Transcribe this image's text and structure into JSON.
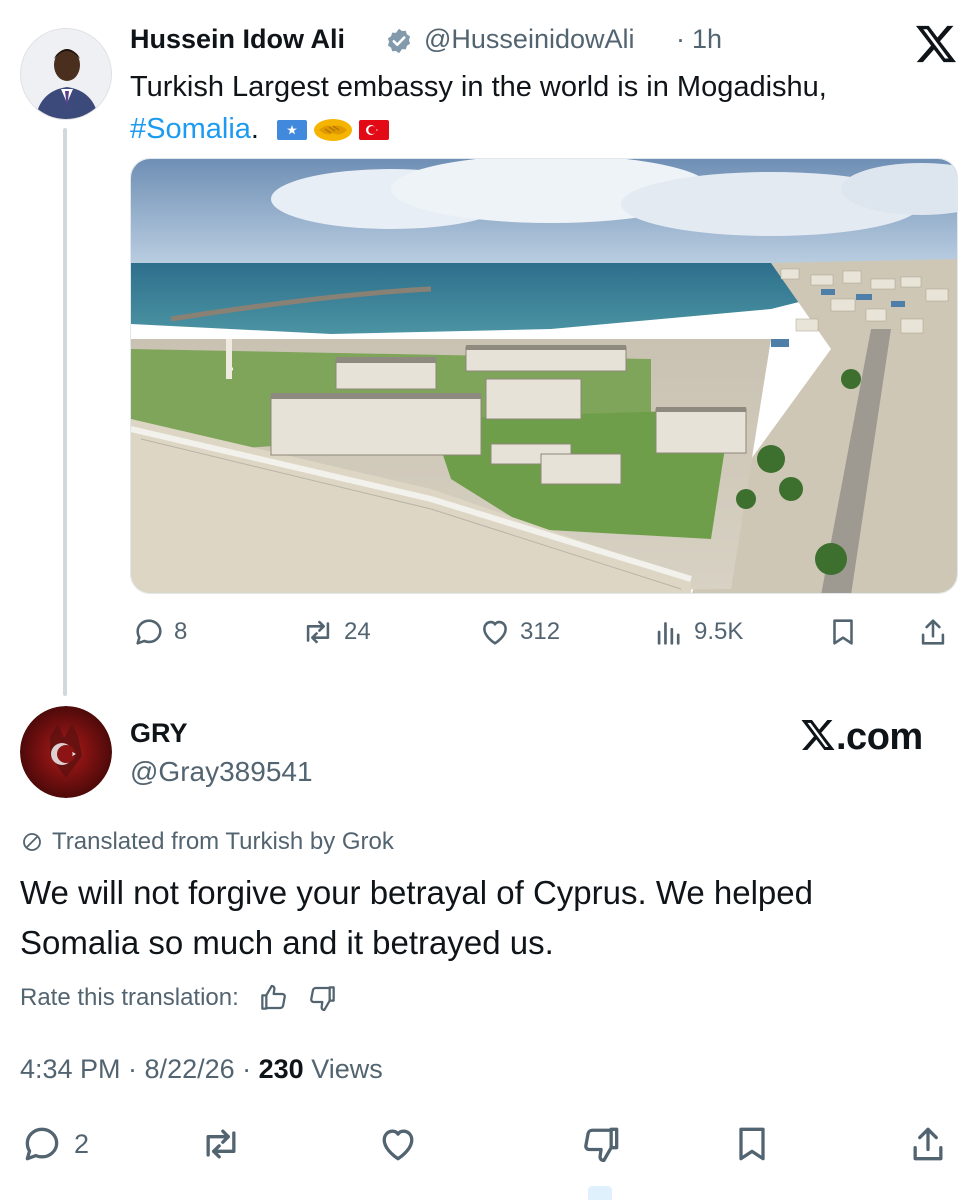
{
  "parent_tweet": {
    "author_name": "Hussein Idow Ali",
    "handle": "@HusseinidowAli",
    "separator": "·",
    "time": "1h",
    "text": "Turkish Largest embassy in the world is in Mogadishu,",
    "hashtag": "#Somalia",
    "text_suffix": ".",
    "emojis": [
      "somalia-flag",
      "handshake",
      "turkey-flag"
    ],
    "actions": {
      "replies": "8",
      "reposts": "24",
      "likes": "312",
      "views": "9.5K"
    }
  },
  "reply_tweet": {
    "author_name": "GRY",
    "handle": "@Gray389541",
    "watermark": "X.com",
    "translated_label": "Translated from Turkish by Grok",
    "text": "We will not forgive your betrayal of Cyprus. We helped Somalia so much and it betrayed us.",
    "rate_label": "Rate this translation:",
    "meta_time": "4:34 PM · 8/22/26 · ",
    "views_count": "230",
    "views_label": " Views",
    "actions": {
      "replies": "2"
    }
  },
  "colors": {
    "accent": "#1d9bf0",
    "secondary_text": "#536471",
    "primary_text": "#0f1419",
    "thread_line": "#cfd9de"
  }
}
